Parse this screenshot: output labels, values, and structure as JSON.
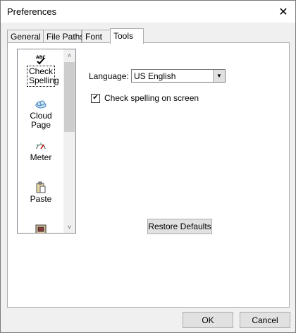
{
  "window": {
    "title": "Preferences",
    "close_glyph": "✕"
  },
  "tabs": [
    {
      "label": "General"
    },
    {
      "label": "File Paths"
    },
    {
      "label": "Font"
    },
    {
      "label": "Tools",
      "active": true
    }
  ],
  "tools_list": {
    "items": [
      {
        "label": "Check Spelling",
        "icon": "spell-check-icon",
        "selected": true
      },
      {
        "label": "Cloud Page",
        "icon": "cloud-icon"
      },
      {
        "label": "Meter",
        "icon": "meter-icon"
      },
      {
        "label": "Paste",
        "icon": "paste-icon"
      },
      {
        "label": "",
        "icon": "tool-icon"
      }
    ],
    "scroll_up": "˄",
    "scroll_down": "˅"
  },
  "language": {
    "label": "Language:",
    "value": "US English",
    "arrow": "▼"
  },
  "spellcheck": {
    "label": "Check spelling on screen",
    "checked": true,
    "mark": "✔"
  },
  "buttons": {
    "restore": "Restore Defaults",
    "ok": "OK",
    "cancel": "Cancel"
  }
}
